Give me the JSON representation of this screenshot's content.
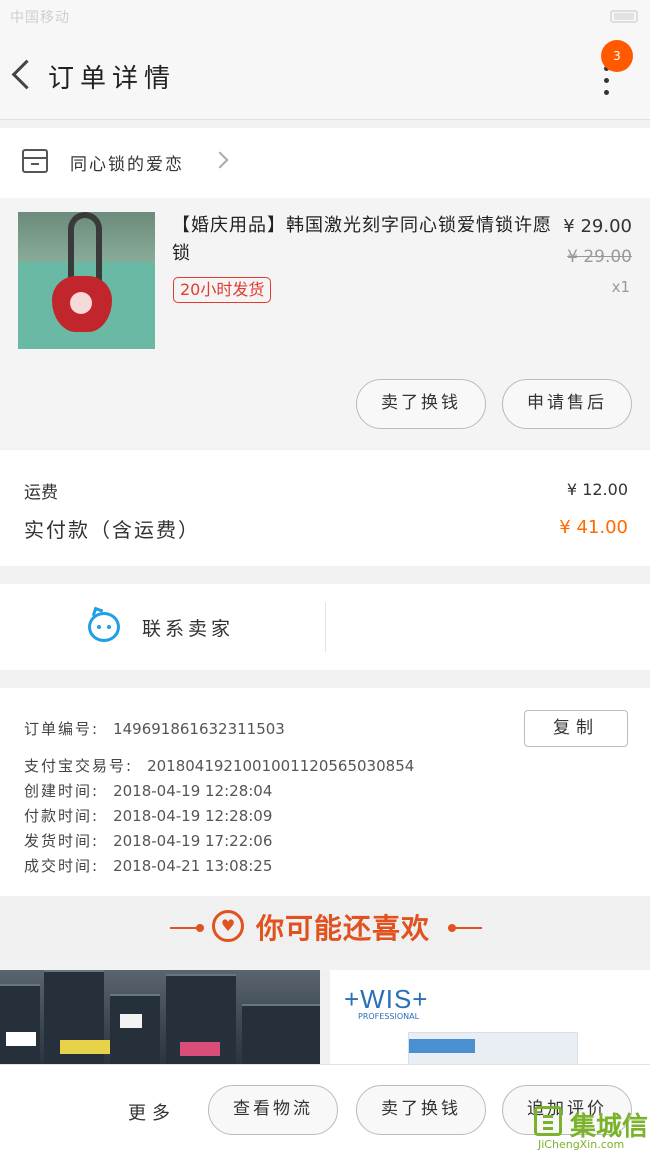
{
  "status_bar": {
    "carrier": "中国移动",
    "time": ""
  },
  "nav": {
    "title": "订单详情",
    "badge": "3"
  },
  "shop": {
    "name": "同心锁的爱恋"
  },
  "product": {
    "title": "【婚庆用品】韩国激光刻字同心锁爱情锁许愿锁",
    "tag": "20小时发货",
    "price": "¥ 29.00",
    "original_price": "¥ 29.00",
    "quantity": "x1",
    "buttons": {
      "sell": "卖了换钱",
      "after_sale": "申请售后"
    }
  },
  "fees": {
    "shipping_label": "运费",
    "shipping_value": "¥ 12.00",
    "paid_label": "实付款（含运费）",
    "paid_value": "¥ 41.00"
  },
  "contact": {
    "label": "联系卖家"
  },
  "order_info": {
    "copy_label": "复制",
    "rows": [
      {
        "key": "订单编号:",
        "value": "149691861632311503"
      },
      {
        "key": "支付宝交易号:",
        "value": "2018041921001001120565030854"
      },
      {
        "key": "创建时间:",
        "value": "2018-04-19 12:28:04"
      },
      {
        "key": "付款时间:",
        "value": "2018-04-19 12:28:09"
      },
      {
        "key": "发货时间:",
        "value": "2018-04-19 17:22:06"
      },
      {
        "key": "成交时间:",
        "value": "2018-04-21 13:08:25"
      }
    ]
  },
  "recommend": {
    "title": "你可能还喜欢",
    "brand": "+WIS+",
    "brand_sub": "PROFESSIONAL"
  },
  "bottom_bar": {
    "more": "更多",
    "logistics": "查看物流",
    "sell": "卖了换钱",
    "review": "追加评价"
  },
  "watermark": {
    "name": "集城信",
    "url": "JiChengXin.com"
  },
  "colors": {
    "accent": "#ff6a00",
    "recommend": "#e0521f",
    "contact_icon": "#1ea0e6",
    "tag": "#e23a2f"
  },
  "icons": {
    "back": "chevron-left-icon",
    "more": "more-vertical-icon",
    "shop": "shop-icon",
    "shop_chevron": "chevron-right-icon",
    "contact": "chat-bubble-icon",
    "recommend": "heart-circle-icon"
  }
}
